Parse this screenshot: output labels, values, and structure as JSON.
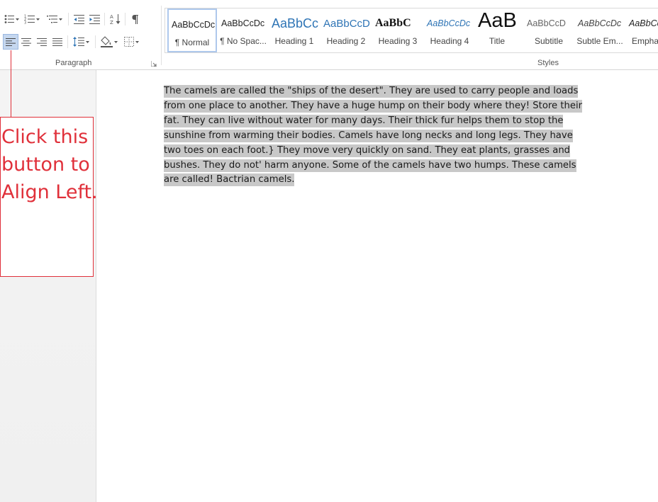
{
  "ribbon": {
    "paragraph_group_label": "Paragraph",
    "styles_group_label": "Styles",
    "paragraph_buttons": [
      {
        "name": "bullets",
        "icon": "bullets-icon"
      },
      {
        "name": "numbering",
        "icon": "numbering-icon"
      },
      {
        "name": "multilevel-list",
        "icon": "multilevel-list-icon"
      },
      {
        "name": "decrease-indent",
        "icon": "decrease-indent-icon"
      },
      {
        "name": "increase-indent",
        "icon": "increase-indent-icon"
      },
      {
        "name": "sort",
        "icon": "sort-icon"
      },
      {
        "name": "show-hide-marks",
        "icon": "pilcrow-icon"
      },
      {
        "name": "align-left",
        "icon": "align-left-icon",
        "active": true
      },
      {
        "name": "center",
        "icon": "align-center-icon"
      },
      {
        "name": "align-right",
        "icon": "align-right-icon"
      },
      {
        "name": "justify",
        "icon": "justify-icon"
      },
      {
        "name": "line-spacing",
        "icon": "line-spacing-icon"
      },
      {
        "name": "shading",
        "icon": "paint-bucket-icon"
      },
      {
        "name": "borders",
        "icon": "borders-icon"
      }
    ],
    "styles": [
      {
        "sample": "AaBbCcDc",
        "name": "¶ Normal",
        "selected": true
      },
      {
        "sample": "AaBbCcDc",
        "name": "¶ No Spac..."
      },
      {
        "sample": "AaBbCc",
        "name": "Heading 1"
      },
      {
        "sample": "AaBbCcD",
        "name": "Heading 2"
      },
      {
        "sample": "AaBbC",
        "name": "Heading 3"
      },
      {
        "sample": "AaBbCcDc",
        "name": "Heading 4"
      },
      {
        "sample": "AaB",
        "name": "Title"
      },
      {
        "sample": "AaBbCcD",
        "name": "Subtitle"
      },
      {
        "sample": "AaBbCcDc",
        "name": "Subtle Em..."
      },
      {
        "sample": "AaBbCc",
        "name": "Empha"
      }
    ]
  },
  "annotation": {
    "text": "Click this button to Align Left.",
    "color": "#e0303a"
  },
  "document": {
    "paragraph": "The camels are called the \"ships of the desert\". They are used to carry people and loads from one place to another. They have a huge hump on their body where they! Store their fat. They can live without water for many days. Their thick fur helps them to stop the sunshine from warming their bodies. Camels have long necks and long legs. They have two toes on each foot.} They move very quickly on sand. They eat plants, grasses and bushes. They do not' harm anyone. Some of the camels have two humps. These camels are called! Bactrian camels.",
    "selected": true
  },
  "colors": {
    "selection": "#c8c8c8",
    "active_button": "#c5d7ef",
    "heading_blue": "#2e74b5",
    "annotation_red": "#e0303a"
  }
}
